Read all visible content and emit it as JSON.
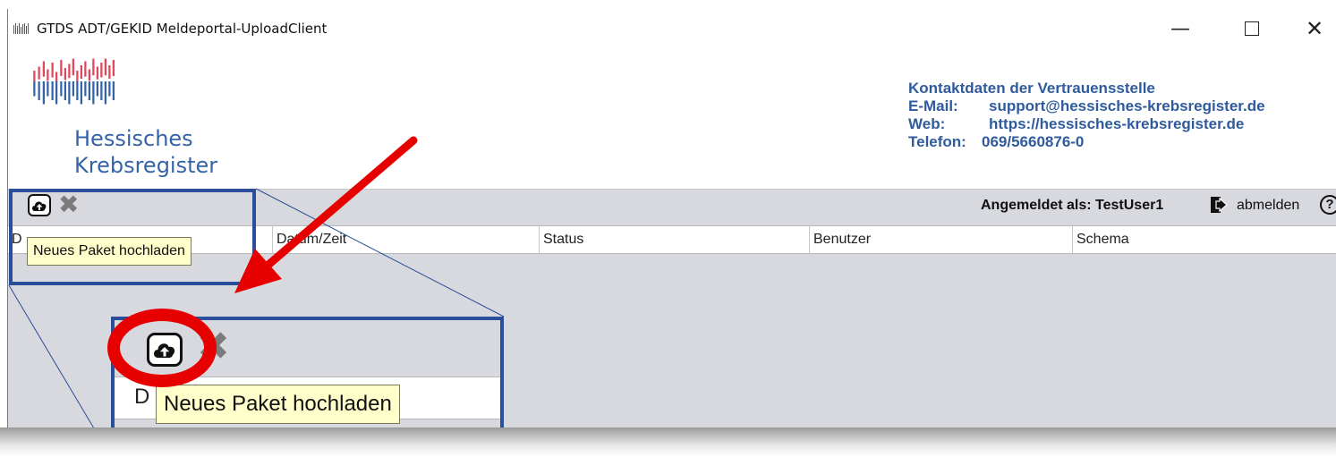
{
  "window": {
    "title": "GTDS ADT/GEKID Meldeportal-UploadClient",
    "controls": {
      "minimize": "—",
      "close": "✕"
    }
  },
  "logo": {
    "line1": "Hessisches",
    "line2": "Krebsregister",
    "colors": {
      "red": "#e0475a",
      "blue": "#3464a8"
    }
  },
  "contact": {
    "heading": "Kontaktdaten der Vertrauensstelle",
    "email_label": "E-Mail:",
    "email": "support@hessisches-krebsregister.de",
    "web_label": "Web:",
    "web": "https://hessisches-krebsregister.de",
    "phone_label": "Telefon:",
    "phone": "069/5660876-0"
  },
  "toolbar": {
    "upload_icon": "cloud-upload-icon",
    "delete_icon": "delete-x-icon",
    "delete_glyph": "✖",
    "logged_in": "Angemeldet als: TestUser1",
    "logout_label": "abmelden",
    "help_glyph": "?"
  },
  "table": {
    "columns": [
      "D",
      "Datum/Zeit",
      "Status",
      "Benutzer",
      "Schema"
    ]
  },
  "tooltip": {
    "text": "Neues Paket hochladen"
  },
  "zoom": {
    "column_initial": "D",
    "tooltip": "Neues Paket hochladen"
  },
  "colors": {
    "accent_blue": "#2b4e9a",
    "annotation_red": "#e60000",
    "toolbar_bg": "#d7d9df",
    "tooltip_bg": "#ffffcc"
  }
}
